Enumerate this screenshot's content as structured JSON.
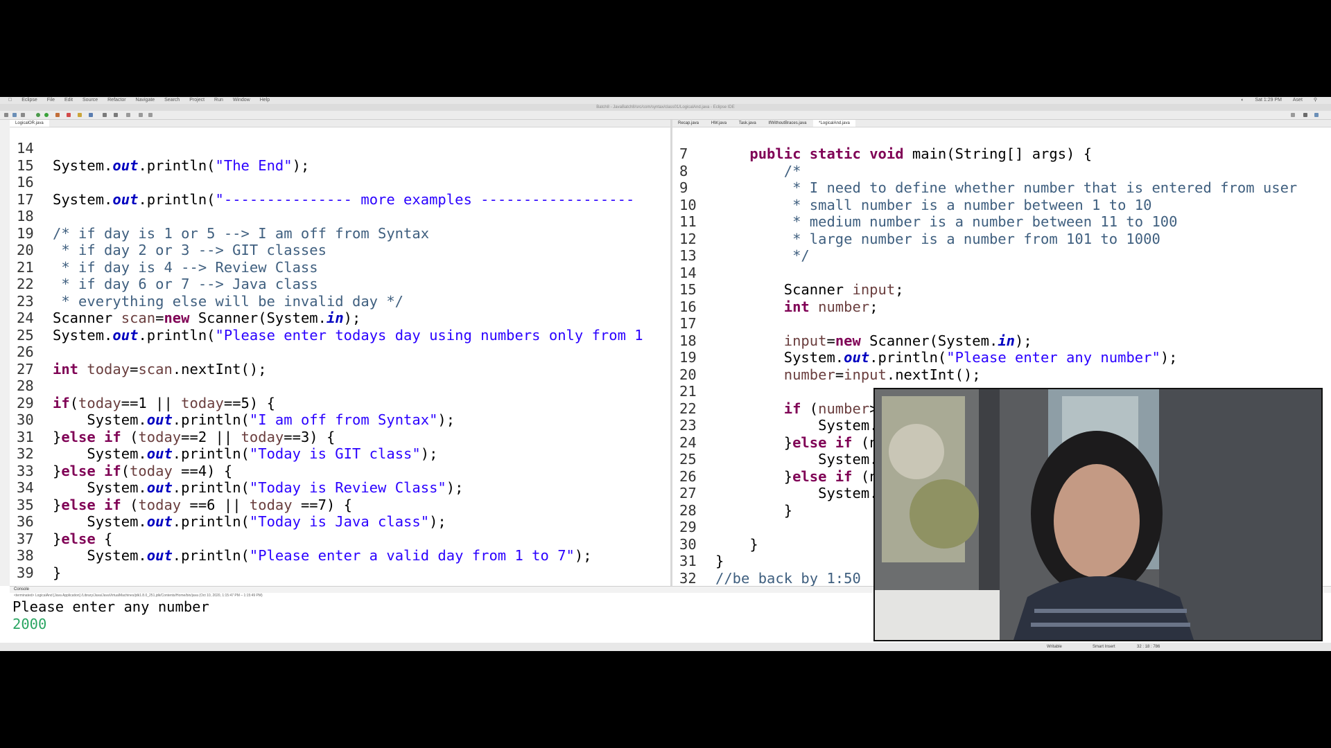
{
  "menubar": {
    "items": [
      "Eclipse",
      "File",
      "Edit",
      "Source",
      "Refactor",
      "Navigate",
      "Search",
      "Project",
      "Run",
      "Window",
      "Help"
    ],
    "clock": "Sat 1:29 PM",
    "user": "Aset"
  },
  "window_title": "Batch8 - JavaBatch8/src/com/syntax/class01/LogicalAnd.java - Eclipse IDE",
  "left_editor": {
    "tab": "LogicalOR.java",
    "lines": [
      {
        "n": "14",
        "code": ""
      },
      {
        "n": "15",
        "code": "System.out.println(\"The End\");"
      },
      {
        "n": "16",
        "code": ""
      },
      {
        "n": "17",
        "code": "System.out.println(\"--------------- more examples ------------------"
      },
      {
        "n": "18",
        "code": ""
      },
      {
        "n": "19",
        "code": "/* if day is 1 or 5 --> I am off from Syntax"
      },
      {
        "n": "20",
        "code": " * if day 2 or 3 --> GIT classes"
      },
      {
        "n": "21",
        "code": " * if day is 4 --> Review Class"
      },
      {
        "n": "22",
        "code": " * if day 6 or 7 --> Java class"
      },
      {
        "n": "23",
        "code": " * everything else will be invalid day */"
      },
      {
        "n": "24",
        "code": "Scanner scan=new Scanner(System.in);"
      },
      {
        "n": "25",
        "code": "System.out.println(\"Please enter todays day using numbers only from 1"
      },
      {
        "n": "26",
        "code": ""
      },
      {
        "n": "27",
        "code": "int today=scan.nextInt();"
      },
      {
        "n": "28",
        "code": ""
      },
      {
        "n": "29",
        "code": "if(today==1 || today==5) {"
      },
      {
        "n": "30",
        "code": "    System.out.println(\"I am off from Syntax\");"
      },
      {
        "n": "31",
        "code": "}else if (today==2 || today==3) {"
      },
      {
        "n": "32",
        "code": "    System.out.println(\"Today is GIT class\");"
      },
      {
        "n": "33",
        "code": "}else if(today ==4) {"
      },
      {
        "n": "34",
        "code": "    System.out.println(\"Today is Review Class\");"
      },
      {
        "n": "35",
        "code": "}else if (today ==6 || today ==7) {"
      },
      {
        "n": "36",
        "code": "    System.out.println(\"Today is Java class\");"
      },
      {
        "n": "37",
        "code": "}else {"
      },
      {
        "n": "38",
        "code": "    System.out.println(\"Please enter a valid day from 1 to 7\");"
      },
      {
        "n": "39",
        "code": "}"
      }
    ]
  },
  "right_editor": {
    "tabs": [
      "Recap.java",
      "HW.java",
      "Task.java",
      "IfWithoutBraces.java",
      "*LogicalAnd.java"
    ],
    "lines": [
      {
        "n": "7",
        "code": "    public static void main(String[] args) {"
      },
      {
        "n": "8",
        "code": "        /*"
      },
      {
        "n": "9",
        "code": "         * I need to define whether number that is entered from user"
      },
      {
        "n": "10",
        "code": "         * small number is a number between 1 to 10"
      },
      {
        "n": "11",
        "code": "         * medium number is a number between 11 to 100"
      },
      {
        "n": "12",
        "code": "         * large number is a number from 101 to 1000"
      },
      {
        "n": "13",
        "code": "         */"
      },
      {
        "n": "14",
        "code": ""
      },
      {
        "n": "15",
        "code": "        Scanner input;"
      },
      {
        "n": "16",
        "code": "        int number;"
      },
      {
        "n": "17",
        "code": ""
      },
      {
        "n": "18",
        "code": "        input=new Scanner(System.in);"
      },
      {
        "n": "19",
        "code": "        System.out.println(\"Please enter any number\");"
      },
      {
        "n": "20",
        "code": "        number=input.nextInt();"
      },
      {
        "n": "21",
        "code": ""
      },
      {
        "n": "22",
        "code": "        if (number>0"
      },
      {
        "n": "23",
        "code": "            System.o"
      },
      {
        "n": "24",
        "code": "        }else if (nu"
      },
      {
        "n": "25",
        "code": "            System.o"
      },
      {
        "n": "26",
        "code": "        }else if (nu"
      },
      {
        "n": "27",
        "code": "            System.o"
      },
      {
        "n": "28",
        "code": "        }"
      },
      {
        "n": "29",
        "code": ""
      },
      {
        "n": "30",
        "code": "    }"
      },
      {
        "n": "31",
        "code": "}"
      },
      {
        "n": "32",
        "code": "//be back by 1:50"
      }
    ]
  },
  "console": {
    "tab": "Console",
    "status": "<terminated> LogicalAnd [Java Application] /Library/Java/JavaVirtualMachines/jdk1.8.0_251.jdk/Contents/Home/bin/java (Oct 10, 2020, 1:15:47 PM – 1:15:49 PM)",
    "output": "Please enter any number",
    "input": "2000"
  },
  "statusbar": {
    "writable": "Writable",
    "insert_mode": "Smart Insert",
    "position": "32 : 18 : 786"
  }
}
